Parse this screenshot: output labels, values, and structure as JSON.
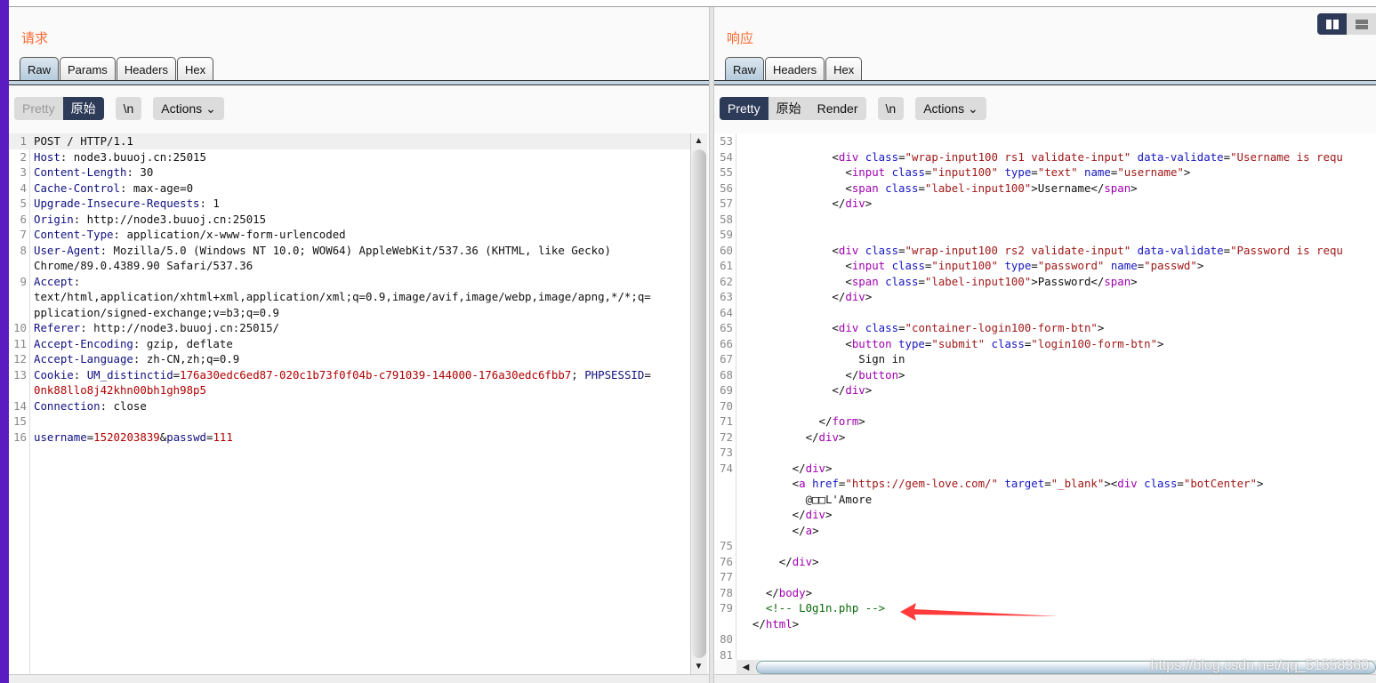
{
  "request": {
    "title": "请求",
    "tabs": [
      "Raw",
      "Params",
      "Headers",
      "Hex"
    ],
    "active_tab": "Raw",
    "view_buttons": [
      "Pretty",
      "原始"
    ],
    "selected_view": "原始",
    "newline_button": "\\n",
    "actions_label": "Actions",
    "lines": [
      {
        "n": "1",
        "t": [
          [
            "t",
            "POST / HTTP/1.1"
          ]
        ]
      },
      {
        "n": "2",
        "t": [
          [
            "k",
            "Host"
          ],
          [
            "t",
            ": node3.buuoj.cn:25015"
          ]
        ]
      },
      {
        "n": "3",
        "t": [
          [
            "k",
            "Content-Length"
          ],
          [
            "t",
            ": 30"
          ]
        ]
      },
      {
        "n": "4",
        "t": [
          [
            "k",
            "Cache-Control"
          ],
          [
            "t",
            ": max-age=0"
          ]
        ]
      },
      {
        "n": "5",
        "t": [
          [
            "k",
            "Upgrade-Insecure-Requests"
          ],
          [
            "t",
            ": 1"
          ]
        ]
      },
      {
        "n": "6",
        "t": [
          [
            "k",
            "Origin"
          ],
          [
            "t",
            ": http://node3.buuoj.cn:25015"
          ]
        ]
      },
      {
        "n": "7",
        "t": [
          [
            "k",
            "Content-Type"
          ],
          [
            "t",
            ": application/x-www-form-urlencoded"
          ]
        ]
      },
      {
        "n": "8",
        "t": [
          [
            "k",
            "User-Agent"
          ],
          [
            "t",
            ": Mozilla/5.0 (Windows NT 10.0; WOW64) AppleWebKit/537.36 (KHTML, like Gecko)"
          ]
        ]
      },
      {
        "n": "",
        "t": [
          [
            "t",
            "Chrome/89.0.4389.90 Safari/537.36"
          ]
        ]
      },
      {
        "n": "9",
        "t": [
          [
            "k",
            "Accept"
          ],
          [
            "t",
            ":"
          ]
        ]
      },
      {
        "n": "",
        "t": [
          [
            "t",
            "text/html,application/xhtml+xml,application/xml;q=0.9,image/avif,image/webp,image/apng,*/*;q="
          ]
        ]
      },
      {
        "n": "",
        "t": [
          [
            "t",
            "pplication/signed-exchange;v=b3;q=0.9"
          ]
        ]
      },
      {
        "n": "10",
        "t": [
          [
            "k",
            "Referer"
          ],
          [
            "t",
            ": http://node3.buuoj.cn:25015/"
          ]
        ]
      },
      {
        "n": "11",
        "t": [
          [
            "k",
            "Accept-Encoding"
          ],
          [
            "t",
            ": gzip, deflate"
          ]
        ]
      },
      {
        "n": "12",
        "t": [
          [
            "k",
            "Accept-Language"
          ],
          [
            "t",
            ": zh-CN,zh;q=0.9"
          ]
        ]
      },
      {
        "n": "13",
        "t": [
          [
            "k",
            "Cookie"
          ],
          [
            "t",
            ": "
          ],
          [
            "k",
            "UM_distinctid"
          ],
          [
            "t",
            "="
          ],
          [
            "r",
            "176a30edc6ed87-020c1b73f0f04b-c791039-144000-176a30edc6fbb7"
          ],
          [
            "t",
            "; "
          ],
          [
            "k",
            "PHPSESSID"
          ],
          [
            "t",
            "="
          ]
        ]
      },
      {
        "n": "",
        "t": [
          [
            "r",
            "0nk88llo8j42khn00bh1gh98p5"
          ]
        ]
      },
      {
        "n": "14",
        "t": [
          [
            "k",
            "Connection"
          ],
          [
            "t",
            ": close"
          ]
        ]
      },
      {
        "n": "15",
        "t": []
      },
      {
        "n": "16",
        "t": [
          [
            "k",
            "username"
          ],
          [
            "t",
            "="
          ],
          [
            "r",
            "1520203839"
          ],
          [
            "t",
            "&"
          ],
          [
            "k",
            "passwd"
          ],
          [
            "t",
            "="
          ],
          [
            "r",
            "111"
          ]
        ]
      }
    ]
  },
  "response": {
    "title": "响应",
    "tabs": [
      "Raw",
      "Headers",
      "Hex"
    ],
    "active_tab": "Raw",
    "view_buttons": [
      "Pretty",
      "原始",
      "Render"
    ],
    "selected_view": "Pretty",
    "newline_button": "\\n",
    "actions_label": "Actions",
    "lines": [
      {
        "n": "53",
        "t": []
      },
      {
        "n": "54",
        "t": [
          [
            "t",
            "              <"
          ],
          [
            "g",
            "div"
          ],
          [
            "a",
            " class"
          ],
          [
            "t",
            "="
          ],
          [
            "v",
            "\"wrap-input100 rs1 validate-input\""
          ],
          [
            "a",
            " data-validate"
          ],
          [
            "t",
            "="
          ],
          [
            "v",
            "\"Username is requ"
          ]
        ]
      },
      {
        "n": "55",
        "t": [
          [
            "t",
            "                <"
          ],
          [
            "g",
            "input"
          ],
          [
            "a",
            " class"
          ],
          [
            "t",
            "="
          ],
          [
            "v",
            "\"input100\""
          ],
          [
            "a",
            " type"
          ],
          [
            "t",
            "="
          ],
          [
            "v",
            "\"text\""
          ],
          [
            "a",
            " name"
          ],
          [
            "t",
            "="
          ],
          [
            "v",
            "\"username\""
          ],
          [
            "t",
            ">"
          ]
        ]
      },
      {
        "n": "56",
        "t": [
          [
            "t",
            "                <"
          ],
          [
            "g",
            "span"
          ],
          [
            "a",
            " class"
          ],
          [
            "t",
            "="
          ],
          [
            "v",
            "\"label-input100\""
          ],
          [
            "t",
            ">Username</"
          ],
          [
            "g",
            "span"
          ],
          [
            "t",
            ">"
          ]
        ]
      },
      {
        "n": "57",
        "t": [
          [
            "t",
            "              </"
          ],
          [
            "g",
            "div"
          ],
          [
            "t",
            ">"
          ]
        ]
      },
      {
        "n": "58",
        "t": []
      },
      {
        "n": "59",
        "t": []
      },
      {
        "n": "60",
        "t": [
          [
            "t",
            "              <"
          ],
          [
            "g",
            "div"
          ],
          [
            "a",
            " class"
          ],
          [
            "t",
            "="
          ],
          [
            "v",
            "\"wrap-input100 rs2 validate-input\""
          ],
          [
            "a",
            " data-validate"
          ],
          [
            "t",
            "="
          ],
          [
            "v",
            "\"Password is requ"
          ]
        ]
      },
      {
        "n": "61",
        "t": [
          [
            "t",
            "                <"
          ],
          [
            "g",
            "input"
          ],
          [
            "a",
            " class"
          ],
          [
            "t",
            "="
          ],
          [
            "v",
            "\"input100\""
          ],
          [
            "a",
            " type"
          ],
          [
            "t",
            "="
          ],
          [
            "v",
            "\"password\""
          ],
          [
            "a",
            " name"
          ],
          [
            "t",
            "="
          ],
          [
            "v",
            "\"passwd\""
          ],
          [
            "t",
            ">"
          ]
        ]
      },
      {
        "n": "62",
        "t": [
          [
            "t",
            "                <"
          ],
          [
            "g",
            "span"
          ],
          [
            "a",
            " class"
          ],
          [
            "t",
            "="
          ],
          [
            "v",
            "\"label-input100\""
          ],
          [
            "t",
            ">Password</"
          ],
          [
            "g",
            "span"
          ],
          [
            "t",
            ">"
          ]
        ]
      },
      {
        "n": "63",
        "t": [
          [
            "t",
            "              </"
          ],
          [
            "g",
            "div"
          ],
          [
            "t",
            ">"
          ]
        ]
      },
      {
        "n": "64",
        "t": []
      },
      {
        "n": "65",
        "t": [
          [
            "t",
            "              <"
          ],
          [
            "g",
            "div"
          ],
          [
            "a",
            " class"
          ],
          [
            "t",
            "="
          ],
          [
            "v",
            "\"container-login100-form-btn\""
          ],
          [
            "t",
            ">"
          ]
        ]
      },
      {
        "n": "66",
        "t": [
          [
            "t",
            "                <"
          ],
          [
            "g",
            "button"
          ],
          [
            "a",
            " type"
          ],
          [
            "t",
            "="
          ],
          [
            "v",
            "\"submit\""
          ],
          [
            "a",
            " class"
          ],
          [
            "t",
            "="
          ],
          [
            "v",
            "\"login100-form-btn\""
          ],
          [
            "t",
            ">"
          ]
        ]
      },
      {
        "n": "67",
        "t": [
          [
            "t",
            "                  Sign in"
          ]
        ]
      },
      {
        "n": "68",
        "t": [
          [
            "t",
            "                </"
          ],
          [
            "g",
            "button"
          ],
          [
            "t",
            ">"
          ]
        ]
      },
      {
        "n": "69",
        "t": [
          [
            "t",
            "              </"
          ],
          [
            "g",
            "div"
          ],
          [
            "t",
            ">"
          ]
        ]
      },
      {
        "n": "70",
        "t": []
      },
      {
        "n": "71",
        "t": [
          [
            "t",
            "            </"
          ],
          [
            "g",
            "form"
          ],
          [
            "t",
            ">"
          ]
        ]
      },
      {
        "n": "72",
        "t": [
          [
            "t",
            "          </"
          ],
          [
            "g",
            "div"
          ],
          [
            "t",
            ">"
          ]
        ]
      },
      {
        "n": "73",
        "t": []
      },
      {
        "n": "74",
        "t": [
          [
            "t",
            "        </"
          ],
          [
            "g",
            "div"
          ],
          [
            "t",
            ">"
          ]
        ]
      },
      {
        "n": "",
        "t": [
          [
            "t",
            "        <"
          ],
          [
            "g",
            "a"
          ],
          [
            "a",
            " href"
          ],
          [
            "t",
            "="
          ],
          [
            "v",
            "\"https://gem-love.com/\""
          ],
          [
            "a",
            " target"
          ],
          [
            "t",
            "="
          ],
          [
            "v",
            "\"_blank\""
          ],
          [
            "t",
            "><"
          ],
          [
            "g",
            "div"
          ],
          [
            "a",
            " class"
          ],
          [
            "t",
            "="
          ],
          [
            "v",
            "\"botCenter\""
          ],
          [
            "t",
            ">"
          ]
        ]
      },
      {
        "n": "",
        "t": [
          [
            "t",
            "          @□□L'Amore"
          ]
        ]
      },
      {
        "n": "",
        "t": [
          [
            "t",
            "        </"
          ],
          [
            "g",
            "div"
          ],
          [
            "t",
            ">"
          ]
        ]
      },
      {
        "n": "",
        "t": [
          [
            "t",
            "        </"
          ],
          [
            "g",
            "a"
          ],
          [
            "t",
            ">"
          ]
        ]
      },
      {
        "n": "75",
        "t": []
      },
      {
        "n": "76",
        "t": [
          [
            "t",
            "      </"
          ],
          [
            "g",
            "div"
          ],
          [
            "t",
            ">"
          ]
        ]
      },
      {
        "n": "77",
        "t": []
      },
      {
        "n": "78",
        "t": [
          [
            "t",
            "    </"
          ],
          [
            "g",
            "body"
          ],
          [
            "t",
            ">"
          ]
        ]
      },
      {
        "n": "79",
        "t": [
          [
            "t",
            "    "
          ],
          [
            "c",
            "<!-- L0g1n.php -->"
          ]
        ]
      },
      {
        "n": "",
        "t": [
          [
            "t",
            "  </"
          ],
          [
            "g",
            "html"
          ],
          [
            "t",
            ">"
          ]
        ]
      },
      {
        "n": "80",
        "t": []
      },
      {
        "n": "81",
        "t": []
      }
    ]
  },
  "layout_toggle": {
    "selected": "columns",
    "options": [
      "columns-icon",
      "rows-icon"
    ]
  },
  "annotation_arrow_color": "#ff3b3b",
  "watermark": "https://blog.csdn.net/qq_51558360"
}
